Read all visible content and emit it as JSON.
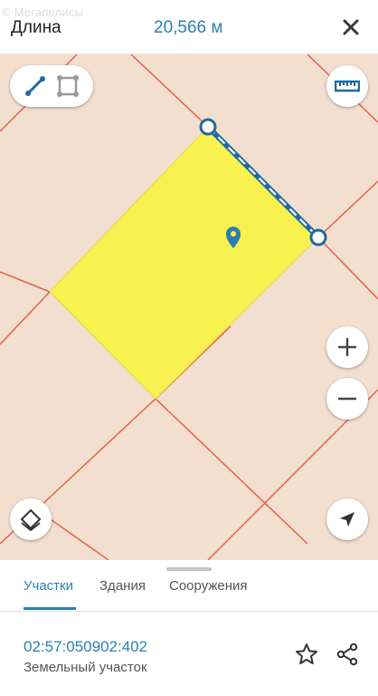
{
  "header": {
    "title": "Длина",
    "length_value": "20,566 м",
    "close_icon": "close-icon",
    "watermark": "© Мегаполисы"
  },
  "map": {
    "background_color": "#f3dfcf",
    "grid_line_color": "#e8604a",
    "parcel_fill_color": "#f7f24f",
    "measure_line_color": "#1f6aa0",
    "tools": {
      "line_tool_icon": "line-measure-icon",
      "area_tool_icon": "area-measure-icon"
    },
    "ruler_icon": "ruler-icon",
    "zoom_in_icon": "plus-icon",
    "zoom_out_icon": "minus-icon",
    "layers_icon": "layers-icon",
    "locate_icon": "navigation-arrow-icon",
    "pin_icon": "map-pin-icon"
  },
  "panel": {
    "tabs": [
      {
        "label": "Участки",
        "active": true
      },
      {
        "label": "Здания",
        "active": false
      },
      {
        "label": "Сооружения",
        "active": false
      }
    ],
    "parcel": {
      "number": "02:57:050902:402",
      "type": "Земельный участок"
    },
    "favorite_icon": "star-icon",
    "share_icon": "share-icon"
  }
}
